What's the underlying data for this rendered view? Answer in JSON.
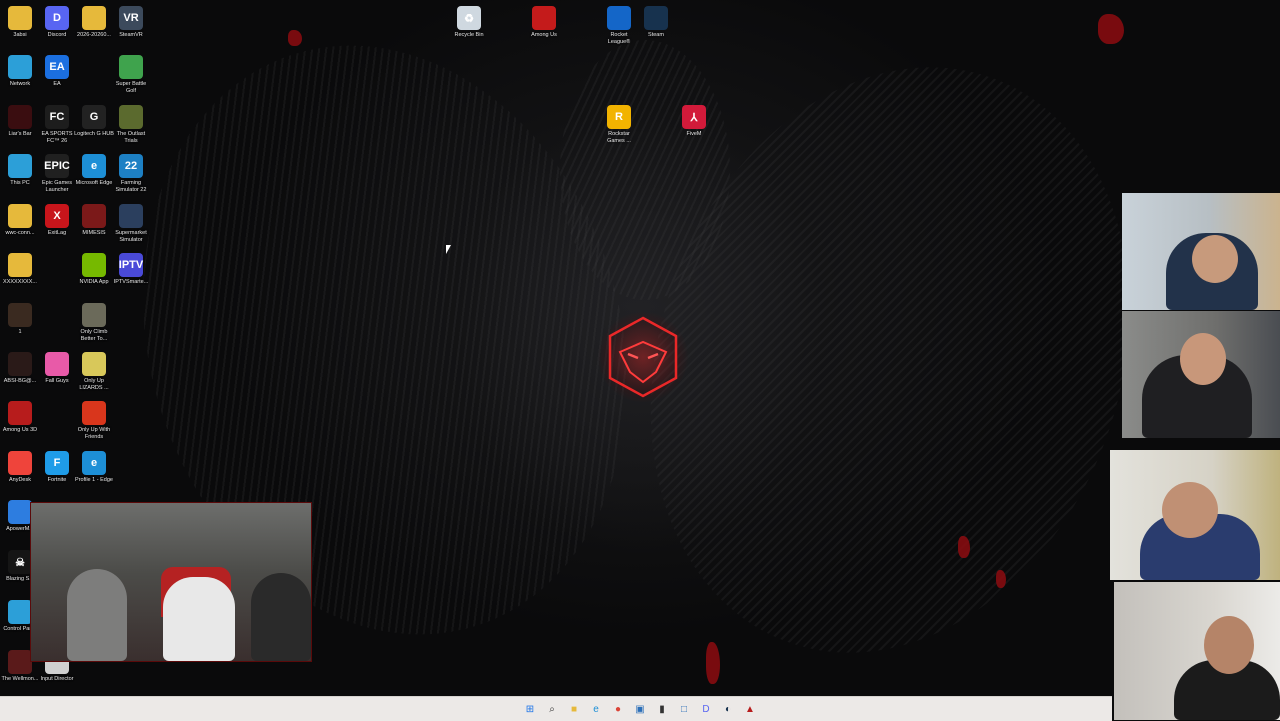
{
  "desktop": {
    "icons": [
      {
        "label": "3absi",
        "color": "#e6b93b",
        "glyph": ""
      },
      {
        "label": "Discord",
        "color": "#5865f2",
        "glyph": "D"
      },
      {
        "label": "2026-20260...",
        "color": "#e6b93b",
        "glyph": ""
      },
      {
        "label": "SteamVR",
        "color": "#3c4a5c",
        "glyph": "VR"
      },
      {
        "label": "Network",
        "color": "#2c9fd8",
        "glyph": ""
      },
      {
        "label": "EA",
        "color": "#1b6fe0",
        "glyph": "EA"
      },
      {
        "label": "Super Battle Golf",
        "color": "#3fa34d",
        "glyph": ""
      },
      {
        "label": "Liar's Bar",
        "color": "#3a0d10",
        "glyph": ""
      },
      {
        "label": "EA SPORTS FC™ 26",
        "color": "#1d1d1d",
        "glyph": "FC"
      },
      {
        "label": "Logitech G HUB",
        "color": "#222222",
        "glyph": "G"
      },
      {
        "label": "The Outlast Trials",
        "color": "#5b6a2e",
        "glyph": ""
      },
      {
        "label": "This PC",
        "color": "#2c9fd8",
        "glyph": ""
      },
      {
        "label": "Epic Games Launcher",
        "color": "#202020",
        "glyph": "EPIC"
      },
      {
        "label": "Microsoft Edge",
        "color": "#1d8fd6",
        "glyph": "e"
      },
      {
        "label": "Farming Simulator 22",
        "color": "#1d80c4",
        "glyph": "22"
      },
      {
        "label": "wwc-conn...",
        "color": "#e6b93b",
        "glyph": ""
      },
      {
        "label": "ExitLag",
        "color": "#c8151b",
        "glyph": "X"
      },
      {
        "label": "MIMESIS",
        "color": "#7b1919",
        "glyph": ""
      },
      {
        "label": "Supermarket Simulator",
        "color": "#2b3f5e",
        "glyph": ""
      },
      {
        "label": "XXXXXXXX...",
        "color": "#e6b93b",
        "glyph": ""
      },
      {
        "label": "NVIDIA App",
        "color": "#76b900",
        "glyph": ""
      },
      {
        "label": "IPTVSmarte...",
        "color": "#4a4ad8",
        "glyph": "IPTV"
      },
      {
        "label": "1",
        "color": "#3a2a20",
        "glyph": ""
      },
      {
        "label": "Only Climb Better To...",
        "color": "#6b6a5a",
        "glyph": ""
      },
      {
        "label": "ABSI-BG@...",
        "color": "#2a1a18",
        "glyph": ""
      },
      {
        "label": "Fall Guys",
        "color": "#e85aa8",
        "glyph": ""
      },
      {
        "label": "Only Up LIZARDS ...",
        "color": "#d8c85a",
        "glyph": ""
      },
      {
        "label": "Among Us 3D",
        "color": "#b71c1c",
        "glyph": ""
      },
      {
        "label": "Only Up With Friends",
        "color": "#d9361c",
        "glyph": ""
      },
      {
        "label": "AnyDesk",
        "color": "#ef443b",
        "glyph": ""
      },
      {
        "label": "Fortnite",
        "color": "#1f9ce8",
        "glyph": "F"
      },
      {
        "label": "Profile 1 - Edge",
        "color": "#1d8fd6",
        "glyph": "e"
      },
      {
        "label": "ApowerM...",
        "color": "#2d7de0",
        "glyph": ""
      },
      {
        "label": "Blazing S...",
        "color": "#151515",
        "glyph": "☠"
      },
      {
        "label": "Control Panel",
        "color": "#2c9fd8",
        "glyph": ""
      },
      {
        "label": "The Wellmon...",
        "color": "#5a1a1a",
        "glyph": ""
      },
      {
        "label": "Input Director",
        "color": "#d0d0d0",
        "glyph": ""
      },
      {
        "label": "Recycle Bin",
        "color": "#cfd8e0",
        "glyph": "♻"
      },
      {
        "label": "Among Us",
        "color": "#c41b1b",
        "glyph": ""
      },
      {
        "label": "Rocket League®",
        "color": "#1466c8",
        "glyph": ""
      },
      {
        "label": "Steam",
        "color": "#17324e",
        "glyph": ""
      },
      {
        "label": "Rockstar Games ...",
        "color": "#f2b300",
        "glyph": "R"
      },
      {
        "label": "FiveM",
        "color": "#d21a3a",
        "glyph": "⅄"
      }
    ]
  },
  "taskbar": {
    "items": [
      {
        "name": "start-button",
        "glyph": "⊞",
        "color": "#1a73e8"
      },
      {
        "name": "search-button",
        "glyph": "⌕",
        "color": "#333333"
      },
      {
        "name": "file-explorer-button",
        "glyph": "■",
        "color": "#e6b93b"
      },
      {
        "name": "edge-button",
        "glyph": "e",
        "color": "#1d8fd6"
      },
      {
        "name": "chrome-button",
        "glyph": "●",
        "color": "#db4437"
      },
      {
        "name": "app-button",
        "glyph": "▣",
        "color": "#2c6fb8"
      },
      {
        "name": "terminal-button",
        "glyph": "▮",
        "color": "#333333"
      },
      {
        "name": "window-button",
        "glyph": "□",
        "color": "#2c6fb8"
      },
      {
        "name": "discord-button",
        "glyph": "D",
        "color": "#5865f2"
      },
      {
        "name": "steam-button",
        "glyph": "◐",
        "color": "#17324e"
      },
      {
        "name": "game-button",
        "glyph": "▲",
        "color": "#b71c1c"
      }
    ]
  }
}
